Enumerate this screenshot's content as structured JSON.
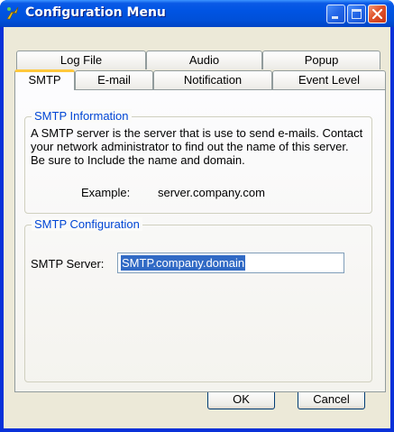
{
  "window": {
    "title": "Configuration Menu",
    "colors": {
      "titlebar": "#0054e3",
      "face": "#ece9d8",
      "group_title": "#0046d5",
      "selection": "#316ac5",
      "active_tab_accent": "#ffc83c"
    }
  },
  "tabs": {
    "row_back": [
      "Log File",
      "Audio",
      "Popup"
    ],
    "row_front": [
      "SMTP",
      "E-mail",
      "Notification",
      "Event Level"
    ],
    "active": "SMTP"
  },
  "smtp_info": {
    "title": "SMTP Information",
    "description": "A SMTP server is the server that is use to send e-mails. Contact your network administrator to find out the name of this server. Be sure to Include the name and domain.",
    "example_label": "Example:",
    "example_value": "server.company.com"
  },
  "smtp_config": {
    "title": "SMTP Configuration",
    "server_label": "SMTP Server:",
    "server_value": "SMTP.company.domain"
  },
  "buttons": {
    "ok": "OK",
    "cancel": "Cancel"
  }
}
